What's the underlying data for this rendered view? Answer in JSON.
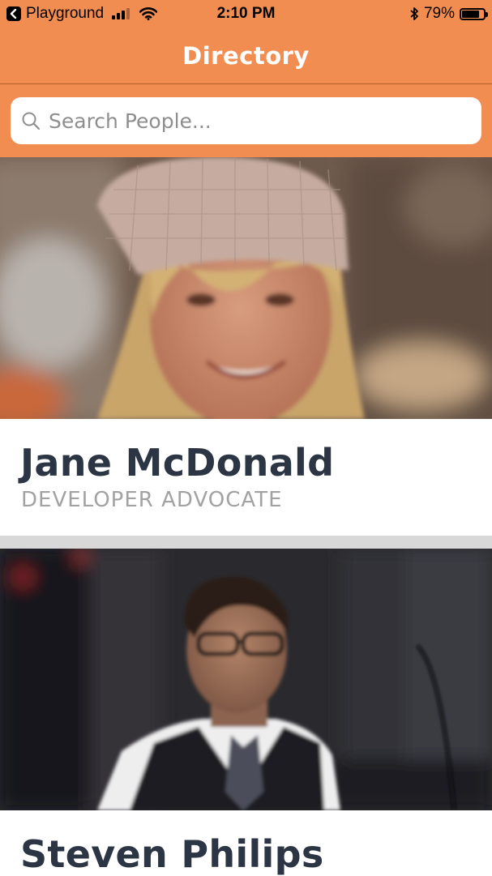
{
  "status_bar": {
    "back_app": "Playground",
    "time": "2:10 PM",
    "battery_percent": "79%",
    "battery_level": 0.79,
    "signal_bars_filled": 3,
    "icons": [
      "back-icon",
      "signal-icon",
      "wifi-icon",
      "bluetooth-icon",
      "battery-icon"
    ]
  },
  "header": {
    "title": "Directory"
  },
  "search": {
    "placeholder": "Search People..."
  },
  "people": [
    {
      "name": "Jane McDonald",
      "title": "DEVELOPER ADVOCATE"
    },
    {
      "name": "Steven Philips",
      "title": ""
    }
  ],
  "colors": {
    "brand": "#f28d52",
    "name_text": "#2c3544",
    "title_text": "#a2a2a2",
    "divider": "#d8d8d8"
  }
}
